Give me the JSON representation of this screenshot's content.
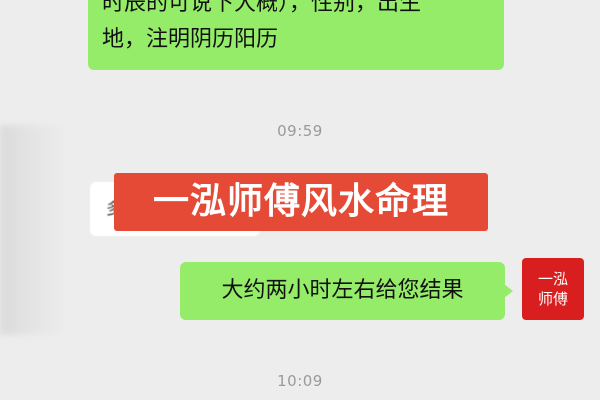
{
  "messages": {
    "top_bubble_line1": "时辰的可说下大概），性别，出生",
    "top_bubble_line2": "地，注明阴历阳历",
    "time_1": "09:59",
    "left_bubble_partial": "多久",
    "reply_bubble": "大约两小时左右给您结果",
    "time_2": "10:09"
  },
  "watermark": {
    "text": "一泓师傅风水命理",
    "color": "#e44a35"
  },
  "avatar": {
    "line1": "一泓",
    "line2": "师傅",
    "color": "#d81e1e"
  },
  "colors": {
    "bubble_green": "#95ec69",
    "background": "#ededed"
  }
}
